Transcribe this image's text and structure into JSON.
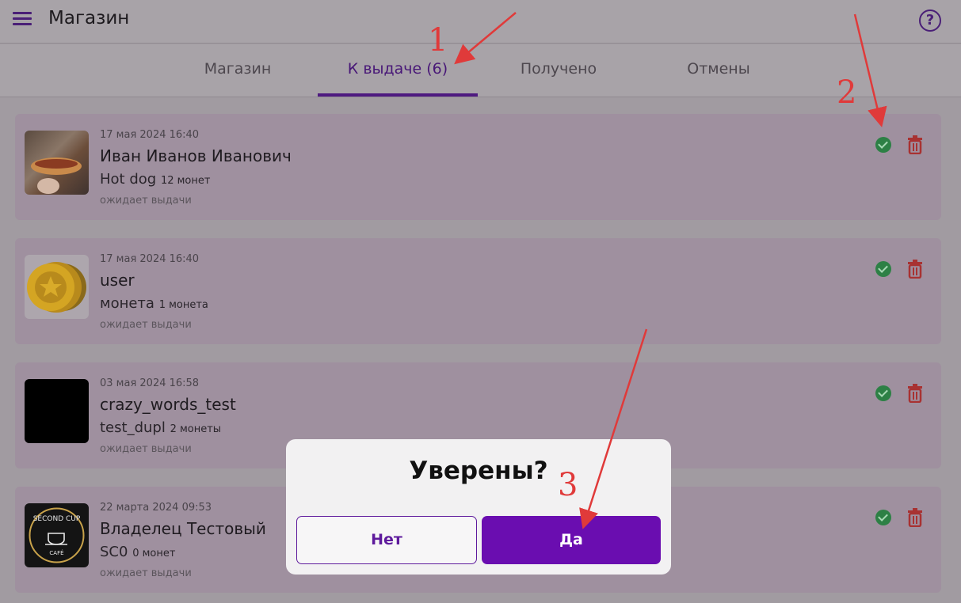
{
  "header": {
    "title": "Магазин",
    "menu_icon": "hamburger-menu-icon",
    "help_icon": "question-circle-icon"
  },
  "tabs": [
    {
      "label": "Магазин",
      "active": false
    },
    {
      "label": "К выдаче (6)",
      "active": true
    },
    {
      "label": "Получено",
      "active": false
    },
    {
      "label": "Отмены",
      "active": false
    }
  ],
  "orders": [
    {
      "date": "17 мая 2024 16:40",
      "name": "Иван Иванов Иванович",
      "item": "Hot dog",
      "coins": "12 монет",
      "status": "ожидает выдачи"
    },
    {
      "date": "17 мая 2024 16:40",
      "name": "user",
      "item": "монета",
      "coins": "1 монета",
      "status": "ожидает выдачи"
    },
    {
      "date": "03 мая 2024 16:58",
      "name": "crazy_words_test",
      "item": "test_dupl",
      "coins": "2 монеты",
      "status": "ожидает выдачи"
    },
    {
      "date": "22 марта 2024 09:53",
      "name": "Владелец Тестовый",
      "item": "SC0",
      "coins": "0 монет",
      "status": "ожидает выдачи"
    }
  ],
  "cafe_logo_text": {
    "top": "SECOND CUP",
    "bottom": "CAFÉ"
  },
  "dialog": {
    "title": "Уверены?",
    "no_label": "Нет",
    "yes_label": "Да"
  },
  "annotations": {
    "one": "1",
    "two": "2",
    "three": "3"
  },
  "colors": {
    "accent": "#6a0db0",
    "annotation": "#e03a3a",
    "confirm": "#2d8045",
    "delete": "#a83232"
  }
}
